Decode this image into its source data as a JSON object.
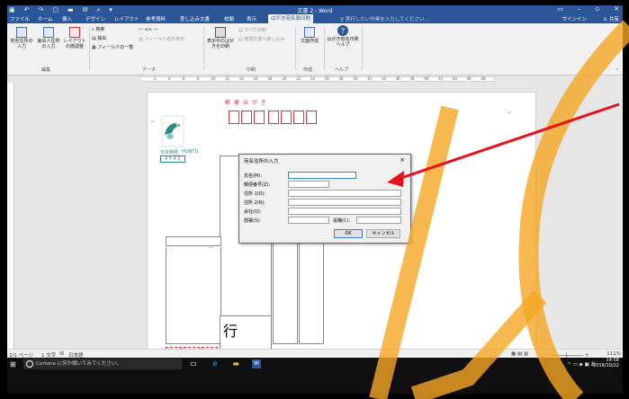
{
  "window": {
    "title": "文書 2 - Word",
    "qat_icons": [
      "save-icon",
      "undo-icon",
      "redo-icon",
      "new-document-icon",
      "open-folder-icon",
      "envelope-icon",
      "print-preview-icon",
      "customize-icon"
    ]
  },
  "tabs": [
    "ファイル",
    "ホーム",
    "挿入",
    "デザイン",
    "レイアウト",
    "参考資料",
    "差し込み文書",
    "校閲",
    "表示",
    "はがき宛名面印刷"
  ],
  "active_tab": "はがき宛名面印刷",
  "tell_me": "実行したい作業を入力してください...",
  "sign_in": "サインイン",
  "share": "共有",
  "ribbon": {
    "address_input": "宛名住所の入力",
    "sender_input": "差出人住所の入力",
    "layout_adjust": "レイアウトの微調整",
    "group_edit": "編集",
    "search": "検索",
    "extract": "抽出",
    "field_list": "フィールドの一覧",
    "field_name_display": "フィールド名の表示",
    "group_data": "データ",
    "print_current": "表示中のはがきを印刷",
    "print_all": "すべて印刷",
    "new_doc_merge": "新規文書へ差し込み",
    "group_print": "印刷",
    "doc_create": "文面作成",
    "group_create": "作成",
    "help": "はがき宛名印刷ヘルプ",
    "group_help": "ヘルプ"
  },
  "ruler_numbers": [
    "2",
    "4",
    "6",
    "8",
    "10",
    "12",
    "14",
    "16",
    "18",
    "20",
    "22",
    "24",
    "26",
    "28",
    "30",
    "32",
    "34",
    "36",
    "38",
    "40",
    "42",
    "44",
    "46",
    "48"
  ],
  "postcard": {
    "header": "郵 便 は が き",
    "gyo": "行",
    "teal_left": "日本郵便",
    "teal_right": "HONTO",
    "teal_code": "4 5 4 2"
  },
  "dialog": {
    "title": "宛名住所の入力",
    "close": "×",
    "fields": {
      "name": "氏名(M):",
      "zip": "郵便番号(Z):",
      "addr1": "住所 1(D):",
      "addr2": "住所 2(R):",
      "company": "会社(O):",
      "dept": "部署(S):",
      "title": "役職(C):"
    },
    "ok": "OK",
    "cancel": "キャンセル"
  },
  "status": {
    "page": "1/1 ページ",
    "words": "1 文字",
    "lang": "日本語",
    "zoom": "111%"
  },
  "taskbar": {
    "cortana": "Cortana に何か聞いてみてください。",
    "time": "14:58",
    "date": "2016/10/22",
    "ime": "あ"
  },
  "colors": {
    "word_blue": "#2b579a",
    "arrow_red": "#e8101a",
    "watermark_orange": "#f5a623",
    "postal_red": "#e03030"
  }
}
